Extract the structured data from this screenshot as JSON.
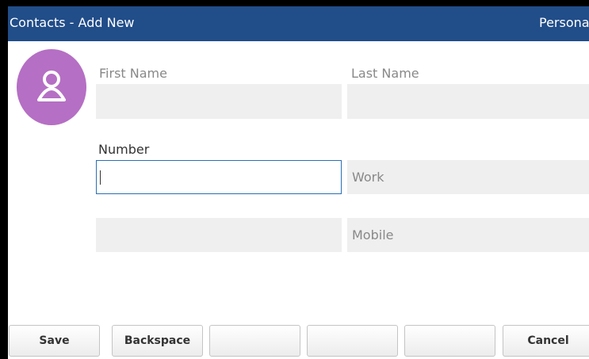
{
  "titlebar": {
    "title": "Contacts - Add New",
    "right_text": "Persona"
  },
  "avatar": {
    "icon": "person-icon"
  },
  "form": {
    "first_name": {
      "label": "First Name",
      "value": ""
    },
    "last_name": {
      "label": "Last Name",
      "value": ""
    },
    "number": {
      "label": "Number",
      "value": ""
    },
    "phone_types": [
      "Work",
      "Mobile"
    ],
    "number2": {
      "value": ""
    }
  },
  "softkeys": [
    "Save",
    "Backspace",
    "",
    "",
    "",
    "Cancel"
  ],
  "colors": {
    "titlebar_bg": "#214d89",
    "avatar_bg": "#b56fc4",
    "field_bg": "#efefef",
    "focus_border": "#2a6fb3"
  }
}
